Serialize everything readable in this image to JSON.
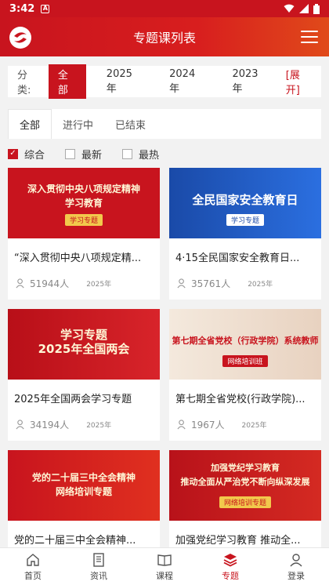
{
  "status_bar": {
    "time": "3:42",
    "a_label": "A"
  },
  "app_bar": {
    "title": "专题课列表"
  },
  "filter": {
    "label": "分类:",
    "chips": [
      "全部",
      "2025年",
      "2024年",
      "2023年"
    ],
    "expand_label": "[展开]"
  },
  "tabs": [
    "全部",
    "进行中",
    "已结束"
  ],
  "sort": {
    "options": [
      "综合",
      "最新",
      "最热"
    ]
  },
  "cards": [
    {
      "banner_text": "深入贯彻中央八项规定精神\n学习教育",
      "banner_sub": "学习专题",
      "title": "“深入贯彻中央八项规定精...",
      "count": "51944人",
      "year": "2025年"
    },
    {
      "banner_text": "全民国家安全教育日",
      "banner_sub": "学习专题",
      "title": "4·15全民国家安全教育日...",
      "count": "35761人",
      "year": "2025年"
    },
    {
      "banner_text": "学习专题\n2025年全国两会",
      "banner_sub": "",
      "title": "2025年全国两会学习专题",
      "count": "34194人",
      "year": "2025年"
    },
    {
      "banner_text": "第七期全省党校（行政学院）系统教师",
      "banner_sub": "网络培训班",
      "title": "第七期全省党校(行政学院)...",
      "count": "1967人",
      "year": "2025年"
    },
    {
      "banner_text": "党的二十届三中全会精神\n网络培训专题",
      "banner_sub": "",
      "title": "党的二十届三中全会精神...",
      "count": "",
      "year": ""
    },
    {
      "banner_text": "加强党纪学习教育\n推动全面从严治党不断向纵深发展",
      "banner_sub": "网络培训专题",
      "title": "加强党纪学习教育 推动全...",
      "count": "",
      "year": ""
    }
  ],
  "bottom_nav": [
    "首页",
    "资讯",
    "课程",
    "专题",
    "登录"
  ],
  "colors": {
    "primary": "#c8141e"
  }
}
